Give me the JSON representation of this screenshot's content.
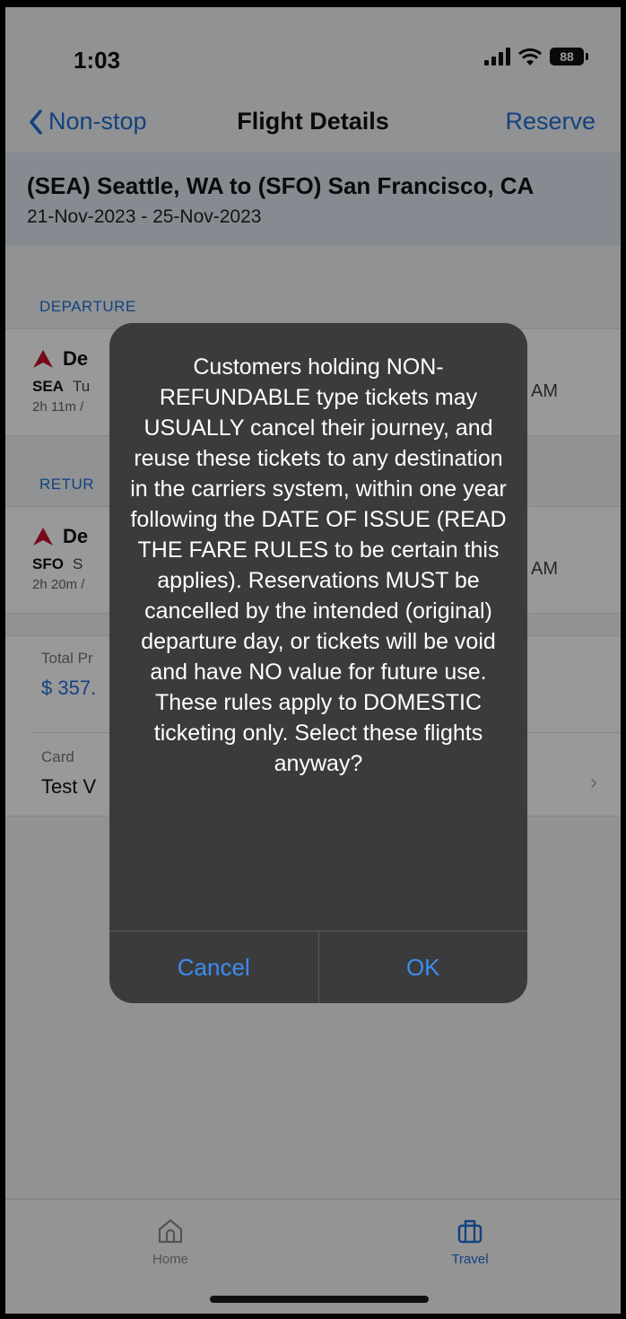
{
  "status": {
    "time": "1:03",
    "battery": "88"
  },
  "nav": {
    "back_label": "Non-stop",
    "title": "Flight Details",
    "action_label": "Reserve"
  },
  "route": {
    "title": "(SEA) Seattle, WA to (SFO) San Francisco, CA",
    "dates": "21-Nov-2023 - 25-Nov-2023"
  },
  "departure": {
    "section_label": "DEPARTURE",
    "airline": "De",
    "airport": "SEA",
    "day": "Tu",
    "duration": "2h 11m /",
    "time": "AM"
  },
  "return": {
    "section_label": "RETUR",
    "airline": "De",
    "airport": "SFO",
    "day": "S",
    "duration": "2h 20m /",
    "time": "AM"
  },
  "total": {
    "label": "Total Pr",
    "value": "$ 357."
  },
  "payment": {
    "label": "Card",
    "value": "Test V"
  },
  "tabs": [
    {
      "label": "Home",
      "icon": "home-icon"
    },
    {
      "label": "Travel",
      "icon": "briefcase-icon"
    }
  ],
  "alert": {
    "message": "Customers holding NON-REFUNDABLE type tickets may USUALLY cancel their journey, and reuse these tickets to any destination in the carriers system, within one year following the DATE OF ISSUE (READ THE FARE RULES to be certain this applies). Reservations MUST be cancelled by the intended (original) departure day, or tickets will be void and have NO value for future use. These rules apply to DOMESTIC ticketing only. Select these flights anyway?",
    "cancel_label": "Cancel",
    "ok_label": "OK"
  },
  "colors": {
    "accent": "#1f6fd6",
    "alert_bg": "#3b3b3d",
    "alert_button": "#3d8cf0",
    "airline_logo": "#c8102e"
  }
}
